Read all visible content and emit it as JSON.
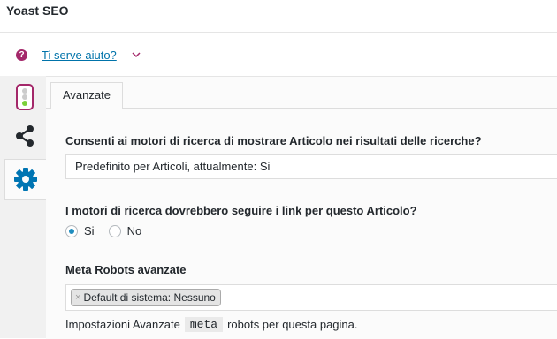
{
  "panel": {
    "title": "Yoast SEO"
  },
  "help": {
    "icon": "question-icon",
    "icon_glyph": "?",
    "link": "Ti serve aiuto?",
    "chevron": "chevron-down-icon"
  },
  "sidebar": {
    "tabs": [
      {
        "name": "readability-traffic-light-icon",
        "active": false
      },
      {
        "name": "share-icon",
        "active": false
      },
      {
        "name": "gear-icon",
        "active": true
      }
    ]
  },
  "tabs": [
    {
      "label": "Avanzate",
      "active": true
    }
  ],
  "fields": {
    "search_visibility": {
      "label": "Consenti ai motori di ricerca di mostrare Articolo nei risultati delle ricerche?",
      "value": "Predefinito per Articoli, attualmente: Si"
    },
    "follow_links": {
      "label": "I motori di ricerca dovrebbero seguire i link per questo Articolo?",
      "options": [
        {
          "label": "Si",
          "checked": true
        },
        {
          "label": "No",
          "checked": false
        }
      ]
    },
    "meta_robots": {
      "label": "Meta Robots avanzate",
      "chip_remove": "×",
      "chip": "Default di sistema: Nessuno",
      "description_prefix": "Impostazioni Avanzate",
      "description_code": "meta",
      "description_suffix": "robots per questa pagina."
    }
  },
  "colors": {
    "accent": "#a4286a",
    "link": "#0073aa",
    "gear": "#0075b3",
    "radio": "#1e8cbe"
  }
}
